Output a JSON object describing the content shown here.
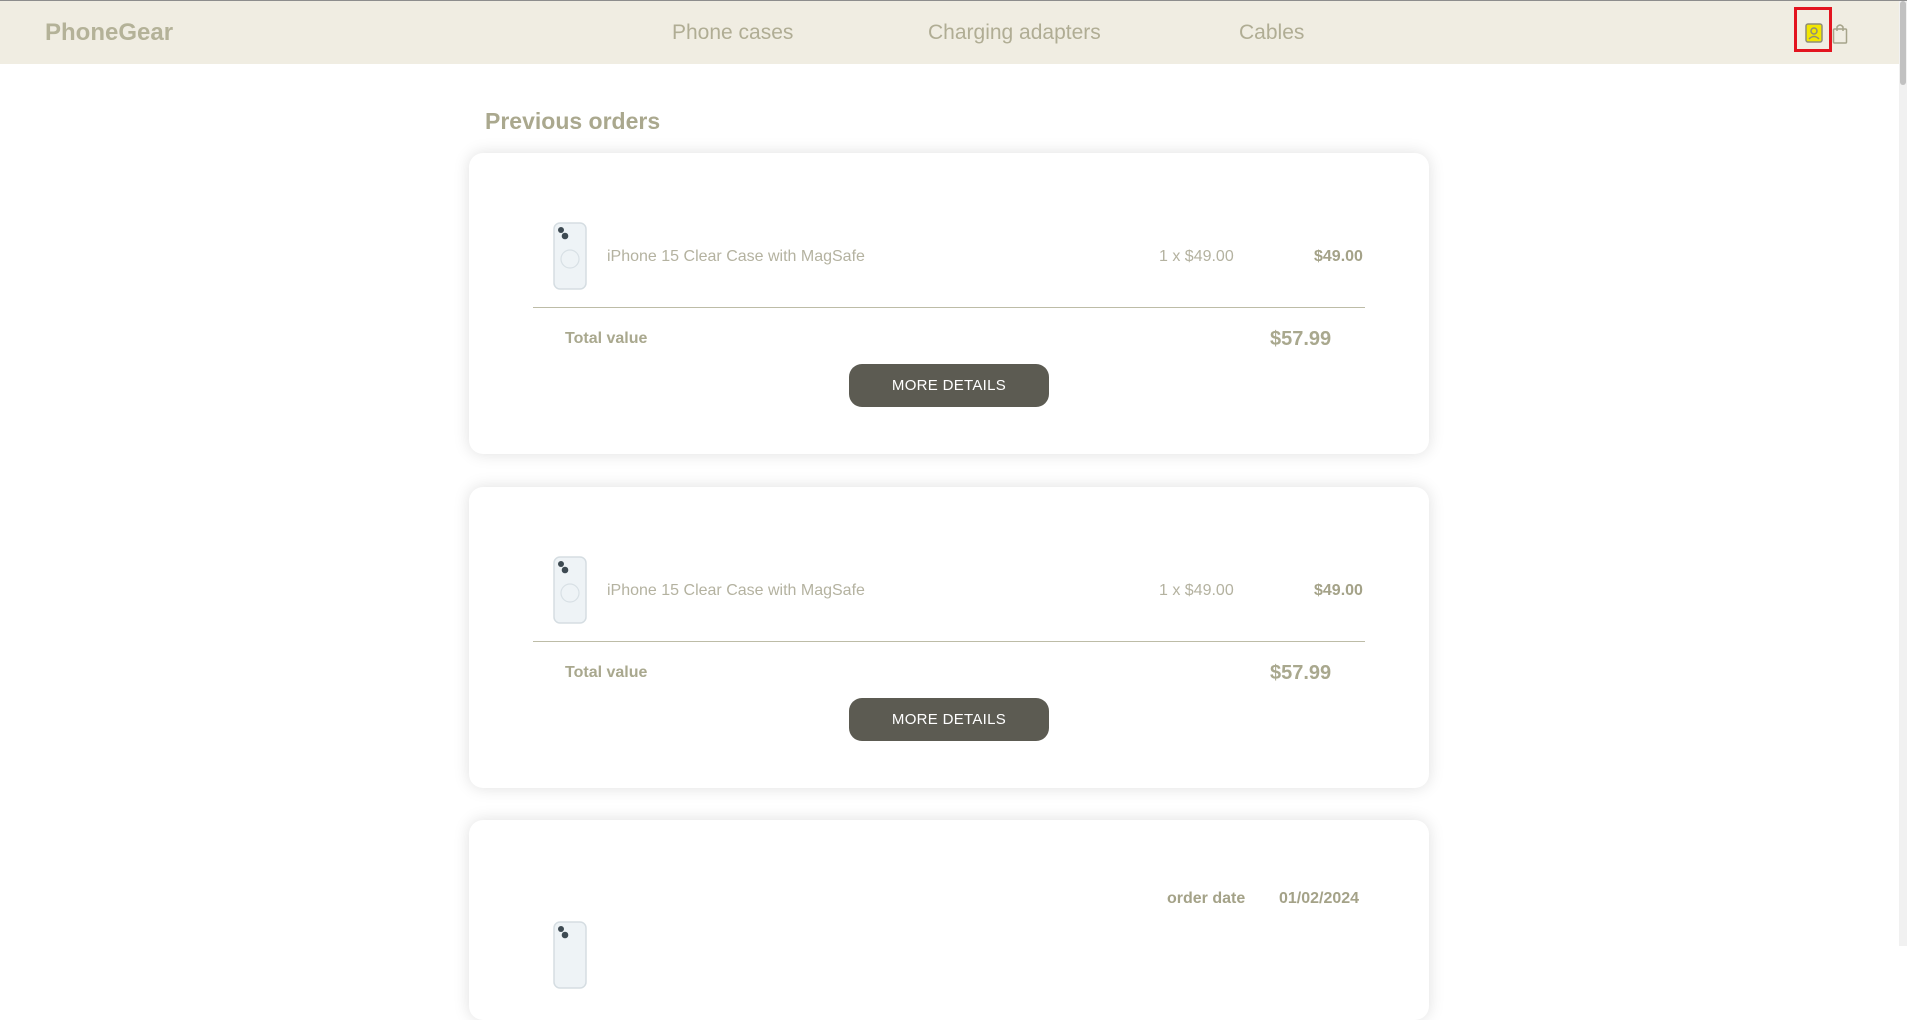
{
  "header": {
    "brand": "PhoneGear",
    "nav": [
      {
        "label": "Phone cases"
      },
      {
        "label": "Charging adapters"
      },
      {
        "label": "Cables"
      }
    ],
    "icons": {
      "account": "account-icon",
      "cart": "shopping-bag-icon"
    }
  },
  "page": {
    "title": "Previous orders"
  },
  "orders": [
    {
      "item": {
        "name": "iPhone 15 Clear Case with MagSafe",
        "qty": "1 x $49.00",
        "price": "$49.00"
      },
      "total_label": "Total value",
      "total_value": "$57.99",
      "button": "MORE DETAILS"
    },
    {
      "item": {
        "name": "iPhone 15 Clear Case with MagSafe",
        "qty": "1 x $49.00",
        "price": "$49.00"
      },
      "total_label": "Total value",
      "total_value": "$57.99",
      "button": "MORE DETAILS"
    },
    {
      "order_date_label": "order date",
      "order_date": "01/02/2024"
    }
  ],
  "colors": {
    "header_bg": "#f0ede2",
    "text": "#a9a88e",
    "button_bg": "#5c5b52",
    "highlight": "#e3141f"
  }
}
